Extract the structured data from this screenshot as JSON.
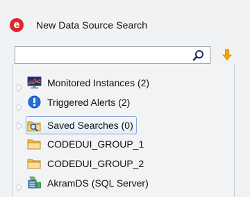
{
  "header": {
    "title": "New Data Source Search",
    "logo_letter": "e",
    "logo_color": "#e0242c"
  },
  "search": {
    "value": "",
    "placeholder": ""
  },
  "tree": {
    "items": [
      {
        "label": "Monitored Instances (2)",
        "icon": "monitor-icon",
        "expandable": true
      },
      {
        "label": "Triggered Alerts (2)",
        "icon": "alert-icon",
        "expandable": true
      },
      {
        "label": "Saved Searches (0)",
        "icon": "saved-search-folder-icon",
        "expandable": true,
        "selected": true
      },
      {
        "label": "CODEDUI_GROUP_1",
        "icon": "folder-icon",
        "expandable": false
      },
      {
        "label": "CODEDUI_GROUP_2",
        "icon": "folder-icon",
        "expandable": false
      },
      {
        "label": "AkramDS (SQL Server)",
        "icon": "database-server-icon",
        "expandable": true
      }
    ]
  },
  "colors": {
    "accent": "#e0242c",
    "selection_border": "#8aa5cf",
    "alert_blue": "#1f6fdc",
    "sort_arrow": "#f5a800"
  }
}
